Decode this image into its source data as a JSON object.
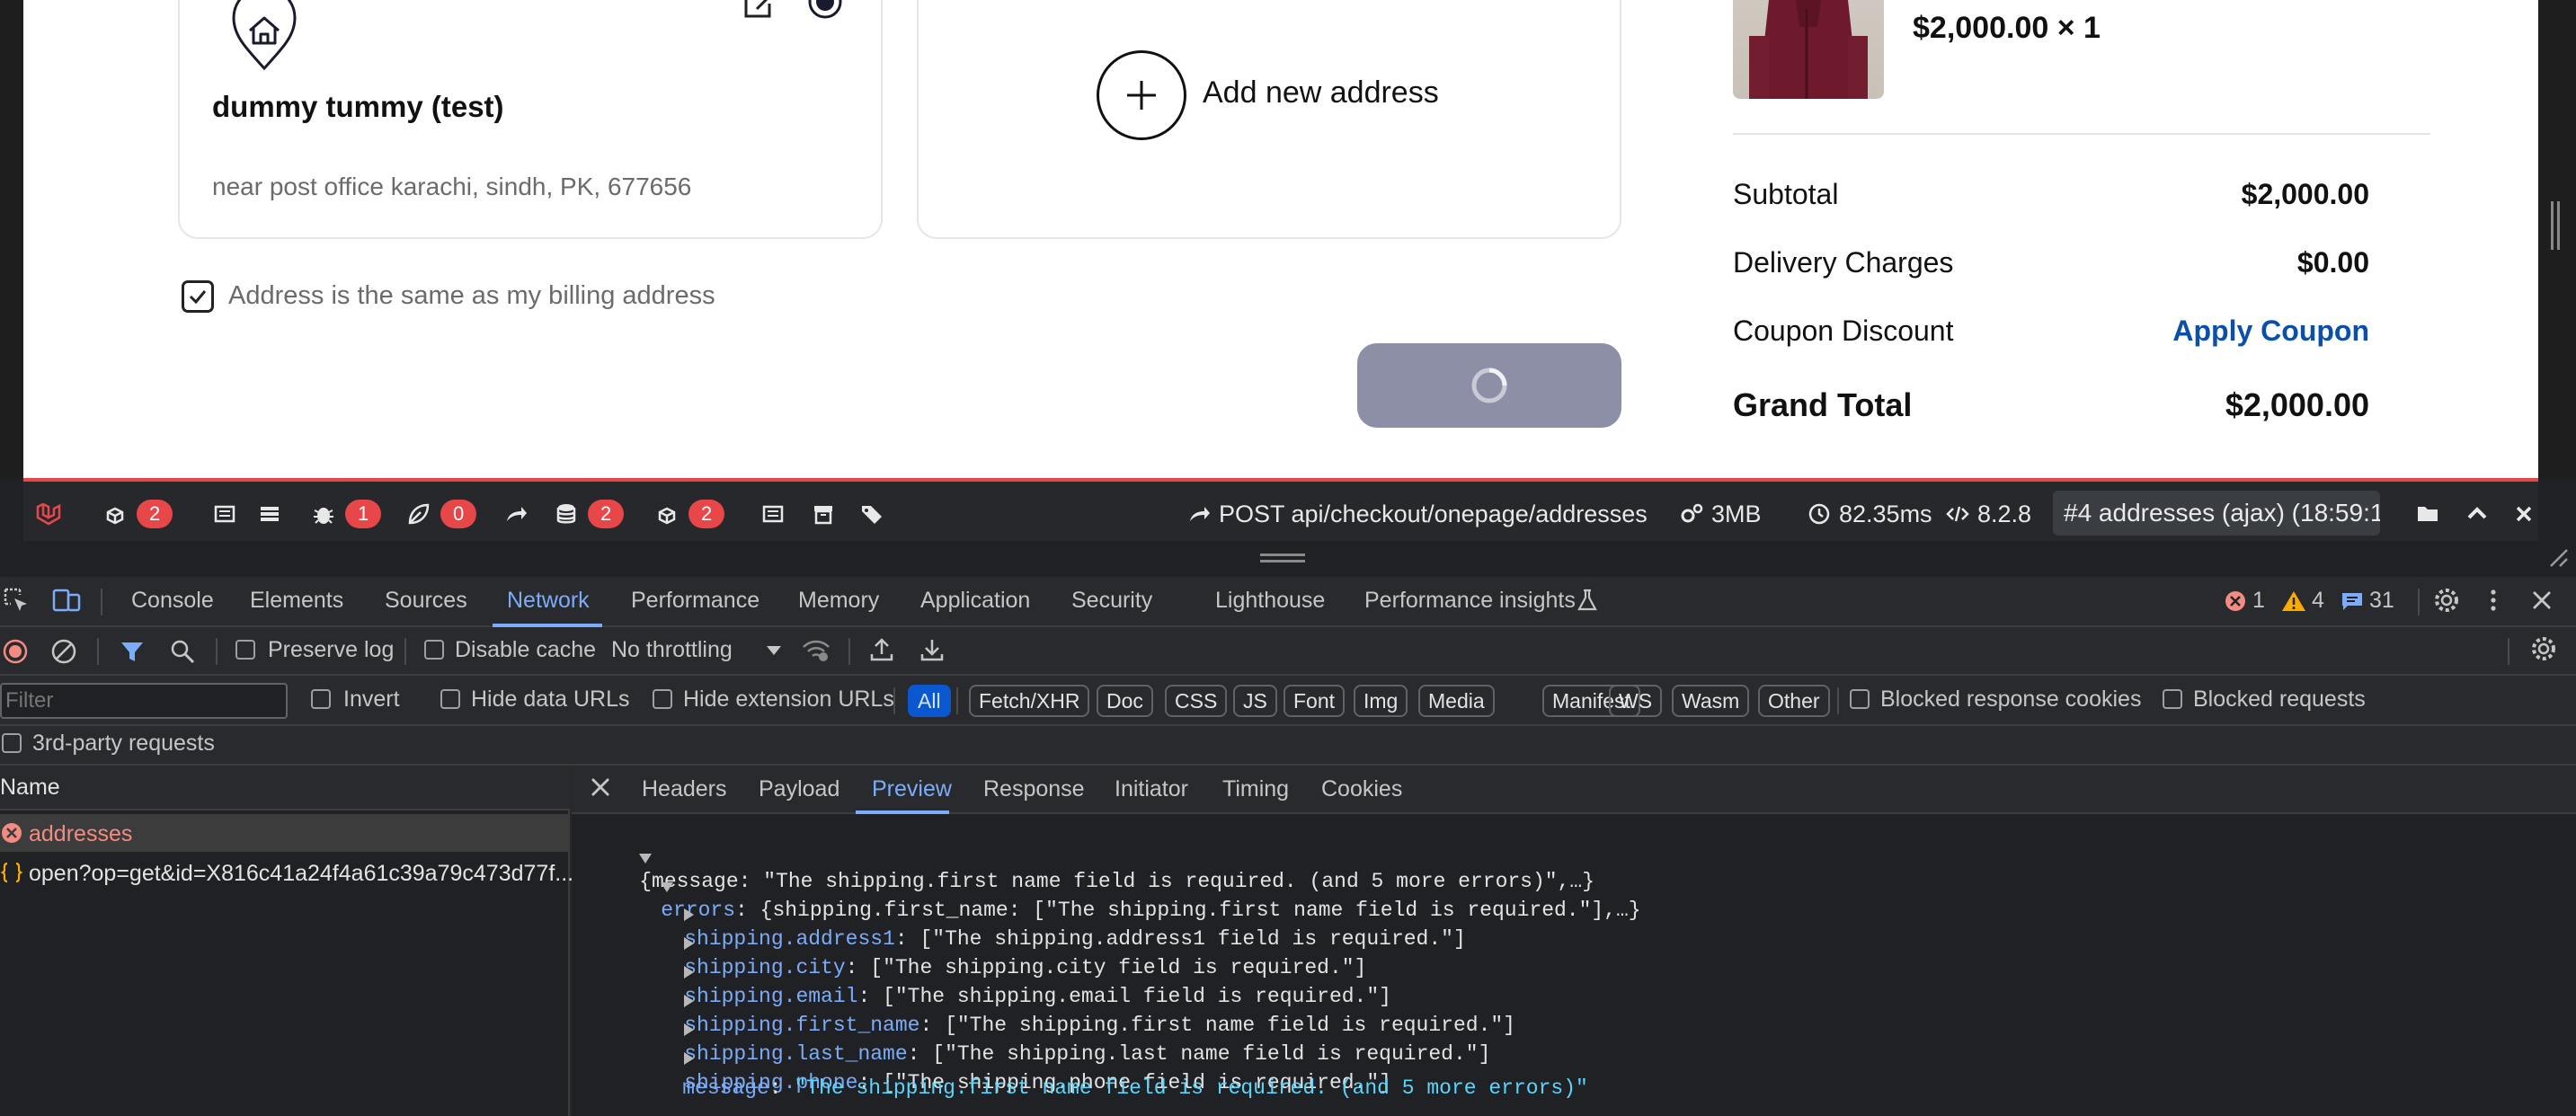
{
  "checkout": {
    "address_name": "dummy tummy (test)",
    "address_line": "near post office karachi, sindh, PK, 677656",
    "add_new_label": "Add new address",
    "billing_same_label": "Address is the same as my billing address",
    "billing_same_checked": true,
    "submit_state": "loading"
  },
  "summary": {
    "item_price": "$2,000.00 × 1",
    "subtotal_label": "Subtotal",
    "subtotal_value": "$2,000.00",
    "delivery_label": "Delivery Charges",
    "delivery_value": "$0.00",
    "coupon_label": "Coupon Discount",
    "coupon_action": "Apply Coupon",
    "grand_label": "Grand Total",
    "grand_value": "$2,000.00"
  },
  "debugbar": {
    "badges": {
      "views": "2",
      "exceptions": "1",
      "events": "0",
      "queries": "2",
      "models": "2"
    },
    "request": "POST api/checkout/onepage/addresses",
    "memory": "3MB",
    "duration": "82.35ms",
    "php_version": "8.2.8",
    "selected_request": "#4 addresses (ajax) (18:59:1"
  },
  "devtools": {
    "tabs": [
      "Console",
      "Elements",
      "Sources",
      "Network",
      "Performance",
      "Memory",
      "Application",
      "Security",
      "Lighthouse",
      "Performance insights"
    ],
    "counts": {
      "errors": "1",
      "warnings": "4",
      "messages": "31"
    },
    "toolbar": {
      "preserve_log": "Preserve log",
      "disable_cache": "Disable cache",
      "throttling": "No throttling"
    },
    "filter": {
      "placeholder": "Filter",
      "invert": "Invert",
      "hide_data_urls": "Hide data URLs",
      "hide_extension_urls": "Hide extension URLs",
      "types": [
        "All",
        "Fetch/XHR",
        "Doc",
        "CSS",
        "JS",
        "Font",
        "Img",
        "Media",
        "Manifest",
        "WS",
        "Wasm",
        "Other"
      ],
      "blocked_cookies": "Blocked response cookies",
      "blocked_requests": "Blocked requests",
      "third_party": "3rd-party requests"
    },
    "requests": {
      "header": "Name",
      "items": [
        "addresses",
        "open?op=get&id=X816c41a24f4a61c39a79c473d77f..."
      ]
    },
    "detail_tabs": [
      "Headers",
      "Payload",
      "Preview",
      "Response",
      "Initiator",
      "Timing",
      "Cookies"
    ],
    "preview": {
      "root": "{message: \"The shipping.first name field is required. (and 5 more errors)\",…}",
      "errors_key": "errors",
      "errors_summary": ": {shipping.first_name: [\"The shipping.first name field is required.\"],…}",
      "fields": [
        {
          "key": "shipping.address1",
          "value": ": [\"The shipping.address1 field is required.\"]"
        },
        {
          "key": "shipping.city",
          "value": ": [\"The shipping.city field is required.\"]"
        },
        {
          "key": "shipping.email",
          "value": ": [\"The shipping.email field is required.\"]"
        },
        {
          "key": "shipping.first_name",
          "value": ": [\"The shipping.first name field is required.\"]"
        },
        {
          "key": "shipping.last_name",
          "value": ": [\"The shipping.last name field is required.\"]"
        },
        {
          "key": "shipping.phone",
          "value": ": [\"The shipping.phone field is required.\"]"
        }
      ],
      "message_key": "message",
      "message_value": "\"The shipping.first name field is required. (and 5 more errors)\""
    }
  }
}
